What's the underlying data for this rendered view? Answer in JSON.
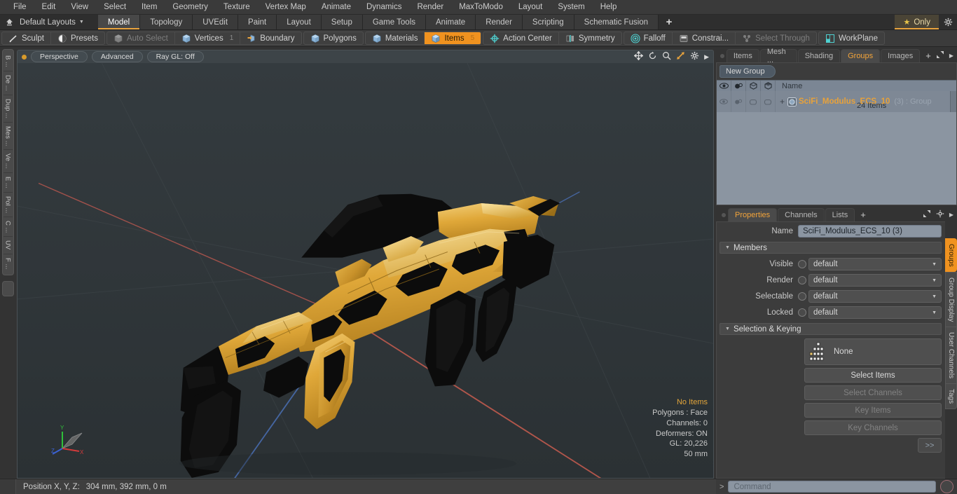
{
  "menubar": {
    "items": [
      "File",
      "Edit",
      "View",
      "Select",
      "Item",
      "Geometry",
      "Texture",
      "Vertex Map",
      "Animate",
      "Dynamics",
      "Render",
      "MaxToModo",
      "Layout",
      "System",
      "Help"
    ]
  },
  "layoutbar": {
    "home_icon": "home-icon",
    "layouts_label": "Default Layouts",
    "caret_icon": "chevron-down-icon",
    "tabs": [
      "Model",
      "Topology",
      "UVEdit",
      "Paint",
      "Layout",
      "Setup",
      "Game Tools",
      "Animate",
      "Render",
      "Scripting",
      "Schematic Fusion"
    ],
    "active_tab": "Model",
    "plus_label": "+",
    "only_label": "Only",
    "star_icon": "star-icon",
    "gear_icon": "gear-icon"
  },
  "toolbar": {
    "groups": [
      {
        "buttons": [
          {
            "label": "Sculpt",
            "icon": "sculpt-icon",
            "state": "normal"
          },
          {
            "label": "Presets",
            "icon": "presets-icon",
            "state": "normal"
          }
        ]
      },
      {
        "buttons": [
          {
            "label": "Auto Select",
            "icon": "cube-gray-icon",
            "state": "dim"
          },
          {
            "label": "Vertices",
            "icon": "cube-blue-icon",
            "state": "normal",
            "count": "1"
          },
          {
            "label": "Boundary",
            "icon": "cube-orange-icon",
            "state": "normal"
          }
        ]
      },
      {
        "buttons": [
          {
            "label": "Polygons",
            "icon": "cube-blue-icon",
            "state": "normal"
          }
        ]
      },
      {
        "buttons": [
          {
            "label": "Materials",
            "icon": "cube-blue-icon",
            "state": "normal"
          },
          {
            "label": "Items",
            "icon": "cube-blue-icon",
            "state": "active",
            "count": "5"
          }
        ]
      },
      {
        "buttons": [
          {
            "label": "Action Center",
            "icon": "action-center-icon",
            "state": "normal"
          },
          {
            "label": "Symmetry",
            "icon": "symmetry-icon",
            "state": "normal"
          }
        ]
      },
      {
        "buttons": [
          {
            "label": "Falloff",
            "icon": "falloff-icon",
            "state": "normal"
          },
          {
            "label": "Constrai...",
            "icon": "constraint-icon",
            "state": "normal"
          },
          {
            "label": "Select Through",
            "icon": "select-through-icon",
            "state": "dim"
          }
        ]
      },
      {
        "buttons": [
          {
            "label": "WorkPlane",
            "icon": "workplane-icon",
            "state": "normal"
          }
        ]
      }
    ]
  },
  "left_strip": {
    "tabs": [
      "B ...",
      "De ...",
      "Dup ...",
      "Mes ...",
      "Ve ...",
      "E ...",
      "Pol ...",
      "C ...",
      "UV",
      "F ..."
    ]
  },
  "viewport": {
    "header": {
      "dot_icon": "status-dot-icon",
      "buttons": [
        "Perspective",
        "Advanced",
        "Ray GL: Off"
      ],
      "icons": [
        "move-icon",
        "rotate-icon",
        "zoom-icon",
        "fit-icon",
        "gear-icon",
        "chevron-right-icon"
      ]
    },
    "stats": [
      {
        "text": "No Items",
        "highlight": true
      },
      {
        "text": "Polygons : Face",
        "highlight": false
      },
      {
        "text": "Channels: 0",
        "highlight": false
      },
      {
        "text": "Deformers: ON",
        "highlight": false
      },
      {
        "text": "GL: 20,226",
        "highlight": false
      },
      {
        "text": "50 mm",
        "highlight": false
      }
    ],
    "gizmo": {
      "x_label": "X",
      "y_label": "Y",
      "z_label": "Z"
    },
    "model": {
      "name": "SciFi_Modulus_ECS_10",
      "gold_color": "#e0a839",
      "dark_color": "#0d0d0d",
      "background_color": "#2f3538"
    }
  },
  "right_panel": {
    "tabs": [
      "Items",
      "Mesh ...",
      "Shading",
      "Groups",
      "Images"
    ],
    "active_tab": "Groups",
    "plus_label": "+",
    "expand_icon": "expand-icon",
    "arrow_icon": "chevron-right-icon",
    "new_group_label": "New Group",
    "list": {
      "columns": [
        "eye-icon",
        "render-icon",
        "wire-icon",
        "shade-icon"
      ],
      "name_header": "Name",
      "rows": [
        {
          "plus": "+",
          "icon": "group-sphere-icon",
          "label": "SciFi_Modulus_ECS_10",
          "suffix": "(3) : Group",
          "count": "24 Items"
        }
      ]
    }
  },
  "properties": {
    "tabs": [
      "Properties",
      "Channels",
      "Lists"
    ],
    "active_tab": "Properties",
    "plus_label": "+",
    "expand_icon": "expand-icon",
    "gear_icon": "gear-icon",
    "arrow_icon": "chevron-right-icon",
    "name_label": "Name",
    "name_value": "SciFi_Modulus_ECS_10 (3)",
    "members_section": "Members",
    "member_rows": [
      {
        "label": "Visible",
        "value": "default"
      },
      {
        "label": "Render",
        "value": "default"
      },
      {
        "label": "Selectable",
        "value": "default"
      },
      {
        "label": "Locked",
        "value": "default"
      }
    ],
    "selection_section": "Selection & Keying",
    "none_label": "None",
    "none_icon": "hierarchy-icon",
    "buttons": [
      {
        "label": "Select Items",
        "state": "normal"
      },
      {
        "label": "Select Channels",
        "state": "dim"
      },
      {
        "label": "Key Items",
        "state": "dim"
      },
      {
        "label": "Key Channels",
        "state": "dim"
      }
    ],
    "more_label": ">>"
  },
  "right_strip": {
    "tabs": [
      "Groups",
      "Group Display",
      "User Channels",
      "Tags"
    ],
    "active_tab": "Groups"
  },
  "statusbar": {
    "position_label": "Position X, Y, Z:",
    "position_value": "304 mm, 392 mm, 0 m",
    "chevron_icon": "chevron-right-icon",
    "command_placeholder": "Command",
    "command_value": "",
    "record_icon": "record-icon"
  }
}
